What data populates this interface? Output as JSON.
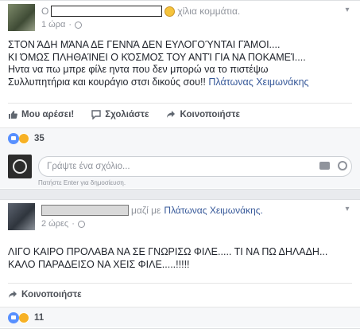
{
  "post1": {
    "header_prefix": "O",
    "header_suffix": "χίλια κομμάτια.",
    "time": "1 ώρα",
    "lines": [
      "ΣΤΟΝ ΆΔΗ ΜΆΝΑ ΔΕ ΓΕΝΝΆ ΔΕΝ ΕΥΛΟΓΟΎΝΤΑΙ ΓΆΜΟΙ....",
      "ΚΙ ΌΜΩΣ ΠΛΗΘΑΊΝΕΙ Ο ΚΌΣΜΟΣ ΤΟΥ ΑΝΤΊ ΓΙΑ ΝΑ ΠΟΚΑΜΕΊ...."
    ],
    "line3": "Ηντα να πω μπρε φίλε ηντα που δεν μπορώ να το πιστέψω",
    "line4_text": "Συλλυπητήρια και κουράγιο στσι δικούς σου!!",
    "line4_tag": "Πλάτωνας Χειμωνάκης",
    "actions": {
      "like": "Μου αρέσει!",
      "comment": "Σχολιάστε",
      "share": "Κοινοποιήστε"
    },
    "reaction_count": "35",
    "comment_placeholder": "Γράψτε ένα σχόλιο...",
    "hint": "Πατήστε Enter για δημοσίευση."
  },
  "post2": {
    "with_text": "μαζί με",
    "tag": "Πλάτωνας Χειμωνάκης.",
    "time": "2 ώρες",
    "lines": [
      "ΛΙΓΟ ΚΑΙΡΟ ΠΡΟΛΑΒΑ ΝΑ ΣΕ ΓΝΩΡΙΣΩ ΦΙΛΕ..... ΤΙ ΝΑ ΠΩ ΔΗΛΑΔΗ...",
      "ΚΑΛΟ ΠΑΡΑΔΕΙΣΟ ΝΑ ΧΕΙΣ ΦΙΛΕ.....!!!!!"
    ],
    "share": "Κοινοποιήστε",
    "reaction_count": "11"
  },
  "colors": {
    "link": "#365899",
    "muted": "#90949c",
    "like": "#5890ff",
    "sad": "#f7b125"
  }
}
